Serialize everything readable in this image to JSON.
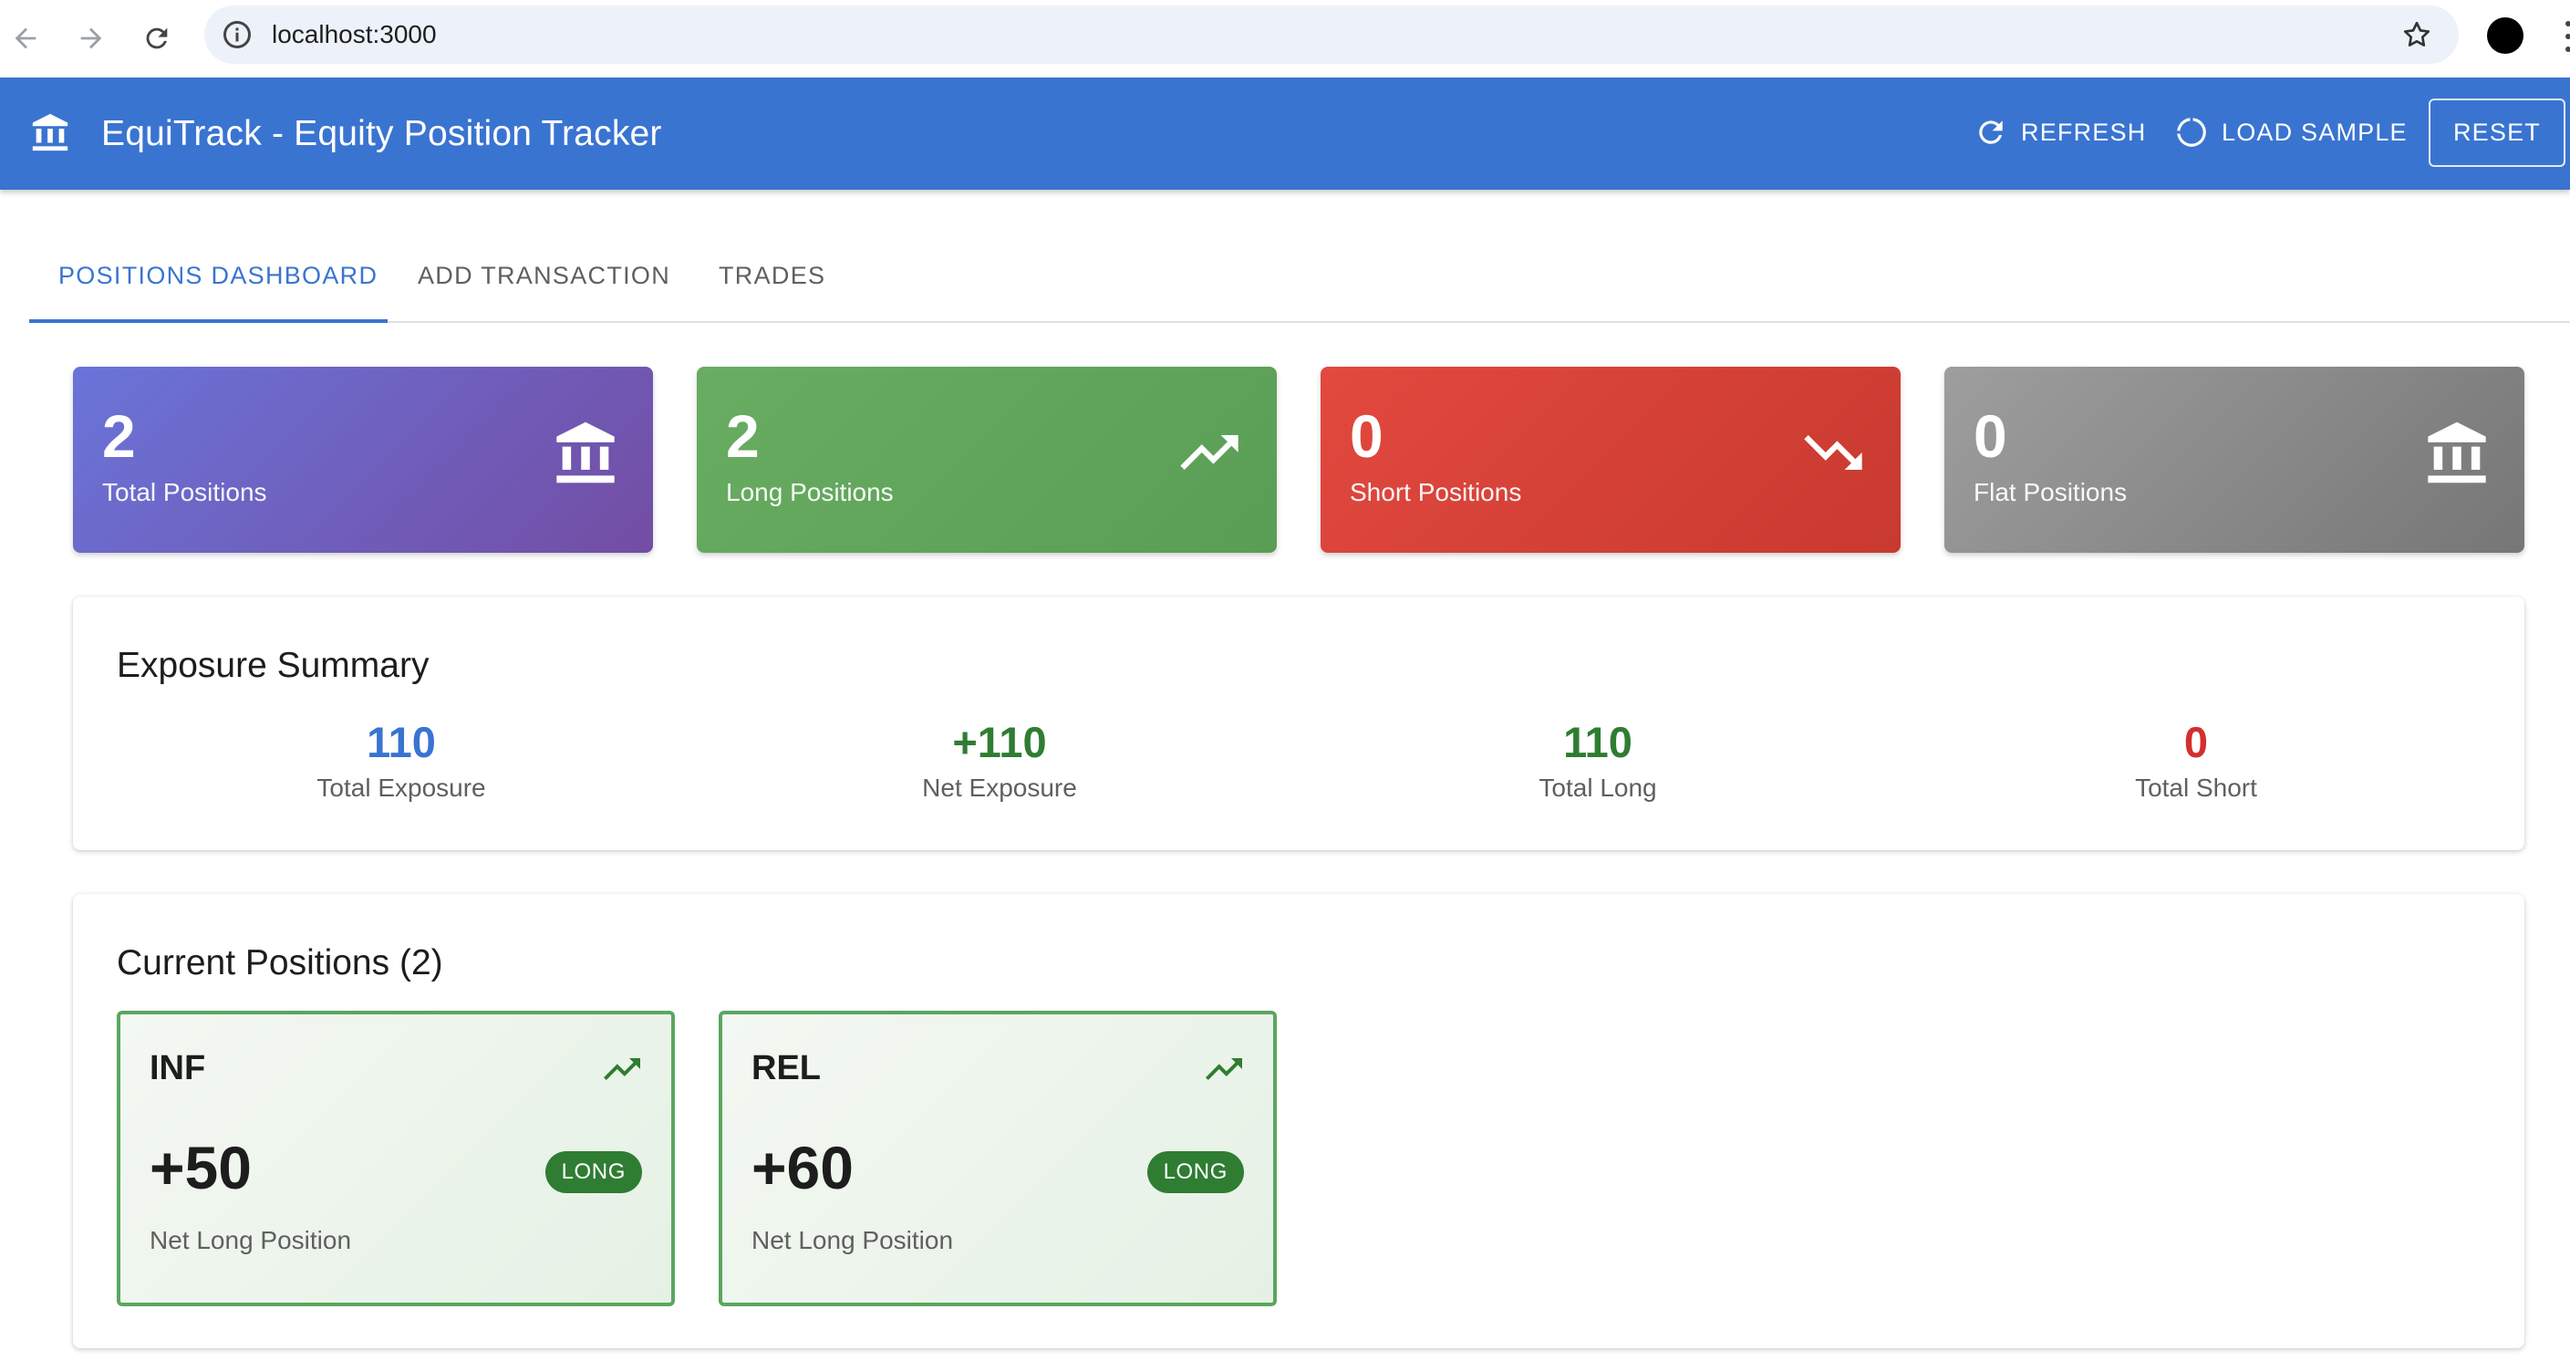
{
  "browser": {
    "url": "localhost:3000",
    "icons": [
      "back-arrow-icon",
      "forward-arrow-icon",
      "reload-icon",
      "info-icon",
      "star-icon"
    ]
  },
  "appbar": {
    "title": "EquiTrack - Equity Position Tracker",
    "refresh_label": "REFRESH",
    "load_sample_label": "LOAD SAMPLE",
    "reset_label": "RESET",
    "color": "#3a74d1"
  },
  "tabs": [
    {
      "label": "POSITIONS DASHBOARD",
      "active": true
    },
    {
      "label": "ADD TRANSACTION",
      "active": false
    },
    {
      "label": "TRADES",
      "active": false
    }
  ],
  "stats": [
    {
      "value": "2",
      "label": "Total Positions",
      "icon": "bank-icon",
      "color_from": "#6a74d9",
      "color_to": "#734da3"
    },
    {
      "value": "2",
      "label": "Long Positions",
      "icon": "trending-up-icon",
      "color_from": "#68ad62",
      "color_to": "#5a9d55"
    },
    {
      "value": "0",
      "label": "Short Positions",
      "icon": "trending-down-icon",
      "color_from": "#e2493f",
      "color_to": "#c8392f"
    },
    {
      "value": "0",
      "label": "Flat Positions",
      "icon": "bank-icon",
      "color_from": "#9e9e9e",
      "color_to": "#767676"
    }
  ],
  "exposure": {
    "title": "Exposure Summary",
    "items": [
      {
        "value": "110",
        "label": "Total Exposure",
        "color": "#3a74d1"
      },
      {
        "value": "+110",
        "label": "Net Exposure",
        "color": "#2e7d32"
      },
      {
        "value": "110",
        "label": "Total Long",
        "color": "#2e7d32"
      },
      {
        "value": "0",
        "label": "Total Short",
        "color": "#d32f2f"
      }
    ]
  },
  "positions": {
    "title": "Current Positions (2)",
    "items": [
      {
        "symbol": "INF",
        "quantity": "+50",
        "badge": "LONG",
        "label": "Net Long Position",
        "icon": "trending-up-icon"
      },
      {
        "symbol": "REL",
        "quantity": "+60",
        "badge": "LONG",
        "label": "Net Long Position",
        "icon": "trending-up-icon"
      }
    ]
  }
}
